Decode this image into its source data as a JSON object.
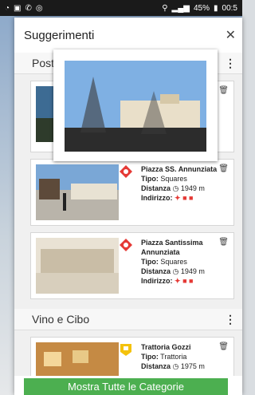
{
  "status_bar": {
    "battery": "45%",
    "time": "00:5"
  },
  "dialog": {
    "title": "Suggerimenti"
  },
  "sections": [
    {
      "title": "Post",
      "cards": [
        {
          "name": "Piazza SS. Annunziata",
          "tipo_label": "Tipo:",
          "tipo": "Squares",
          "distanza_label": "Distanza",
          "distanza": "1949 m",
          "indirizzo_label": "Indirizzo:"
        },
        {
          "name": "Piazza Santissima Annunziata",
          "tipo_label": "Tipo:",
          "tipo": "Squares",
          "distanza_label": "Distanza",
          "distanza": "1949 m",
          "indirizzo_label": "Indirizzo:"
        }
      ]
    },
    {
      "title": "Vino e Cibo",
      "cards": [
        {
          "name": "Trattoria Gozzi",
          "tipo_label": "Tipo:",
          "tipo": "Trattoria",
          "distanza_label": "Distanza",
          "distanza": "1975 m"
        }
      ]
    }
  ],
  "footer": {
    "label": "Mostra Tutte le Categorie"
  },
  "icons": {
    "trash": "trash-icon",
    "pin": "map-pin-icon",
    "walk": "walk-icon",
    "car": "car-icon",
    "bus": "bus-icon",
    "clock": "clock-icon"
  },
  "colors": {
    "accent_green": "#4caf50",
    "pin_red": "#e53935"
  }
}
